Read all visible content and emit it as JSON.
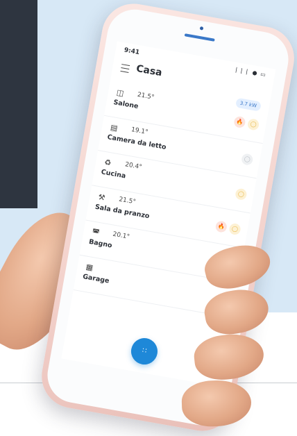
{
  "status_bar": {
    "time": "9:41",
    "icons": "❘❘❘ ● ▭"
  },
  "app_bar": {
    "title": "Casa"
  },
  "power_badge": "3.7 kW",
  "rooms": [
    {
      "name": "Salone",
      "temp": "21.5°",
      "icon": "sofa-icon",
      "badges": [
        "flame",
        "bulb"
      ]
    },
    {
      "name": "Camera da letto",
      "temp": "19.1°",
      "icon": "bed-icon",
      "badges": [
        "off"
      ]
    },
    {
      "name": "Cucina",
      "temp": "20.4°",
      "icon": "pot-icon",
      "badges": [
        "bulb"
      ]
    },
    {
      "name": "Sala da pranzo",
      "temp": "21.5°",
      "icon": "cutlery-icon",
      "badges": [
        "flame",
        "bulb"
      ]
    },
    {
      "name": "Bagno",
      "temp": "20.1°",
      "icon": "bathtub-icon",
      "badges": [
        "off"
      ]
    },
    {
      "name": "Garage",
      "temp": "",
      "icon": "garage-icon",
      "badges": [
        "off"
      ]
    }
  ],
  "fab": {
    "icon": "grid-icon"
  },
  "colors": {
    "accent": "#1e88d8",
    "flame": "#e07056",
    "bulb": "#e7b642",
    "background": "#d7e8f6"
  }
}
